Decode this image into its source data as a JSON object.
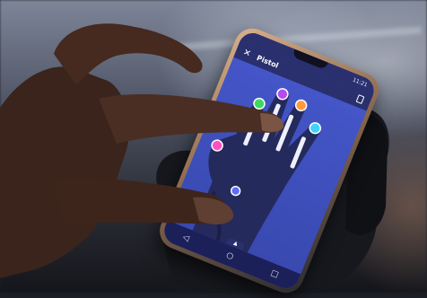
{
  "app": {
    "title": "Pistol",
    "status_left": "",
    "status_right": "11:21"
  },
  "nav": {
    "back_icon": "triangle-back-icon",
    "home_icon": "circle-home-icon",
    "recent_icon": "square-recent-icon"
  },
  "finger_colors": {
    "thumb": "#ff4fc3",
    "index": "#3cd860",
    "middle": "#b04cf0",
    "ring": "#ff9a3c",
    "pinky": "#3fd2ff"
  },
  "icons": [
    "close-icon",
    "battery-icon",
    "chevron-up-icon"
  ]
}
